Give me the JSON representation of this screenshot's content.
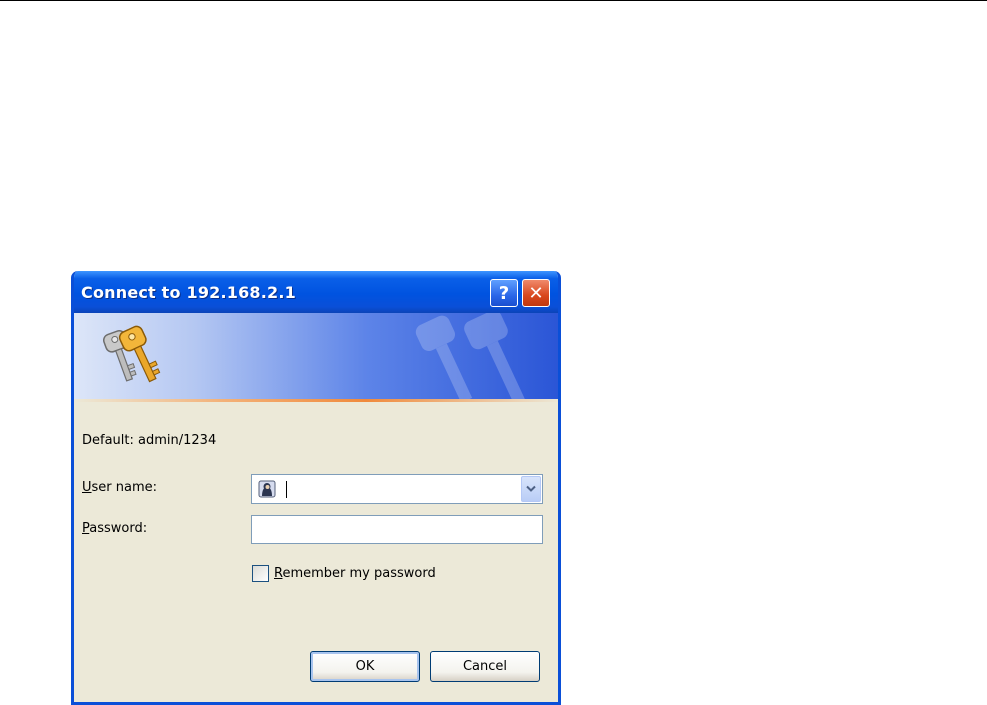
{
  "dialog": {
    "title": "Connect to 192.168.2.1",
    "help_glyph": "?",
    "close_glyph": "✕",
    "default_hint": "Default: admin/1234",
    "username": {
      "label_first": "U",
      "label_rest": "ser name:",
      "value": ""
    },
    "password": {
      "label_first": "P",
      "label_rest": "assword:",
      "value": ""
    },
    "remember": {
      "label_first": "R",
      "label_rest": "emember my password",
      "checked": false
    },
    "ok_label": "OK",
    "cancel_label": "Cancel"
  },
  "icons": {
    "banner": "keys-icon",
    "user": "user-icon",
    "dropdown": "chevron-down-icon"
  },
  "colors": {
    "titlebar": "#0a4fd8",
    "dialog_bg": "#ece9d8",
    "close_button": "#d9471c",
    "accent_line": "#f08a3c"
  }
}
